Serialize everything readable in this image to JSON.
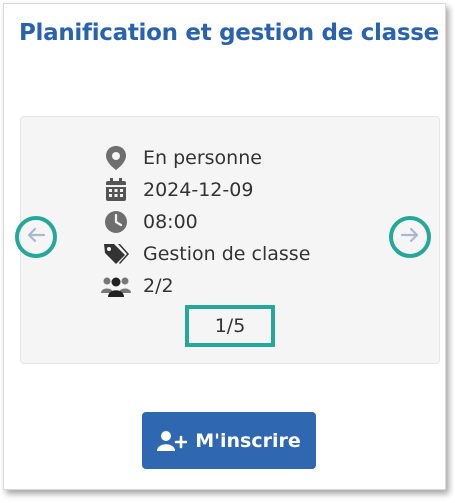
{
  "title": "Planification et gestion de classe",
  "session": {
    "mode": "En personne",
    "date": "2024-12-09",
    "time": "08:00",
    "category": "Gestion de classe",
    "capacity": "2/2"
  },
  "pagination": {
    "label": "1/5"
  },
  "register_label": "M'inscrire",
  "icons": {
    "mode": "map-marker-icon",
    "date": "calendar-icon",
    "time": "clock-icon",
    "category": "tag-icon",
    "capacity": "users-icon",
    "prev": "arrow-left-icon",
    "next": "arrow-right-icon",
    "register": "user-plus-icon"
  },
  "colors": {
    "title": "#2a63ad",
    "accent_highlight": "#24a89a",
    "button": "#2f68b0",
    "icon": "#6e6e6e"
  }
}
